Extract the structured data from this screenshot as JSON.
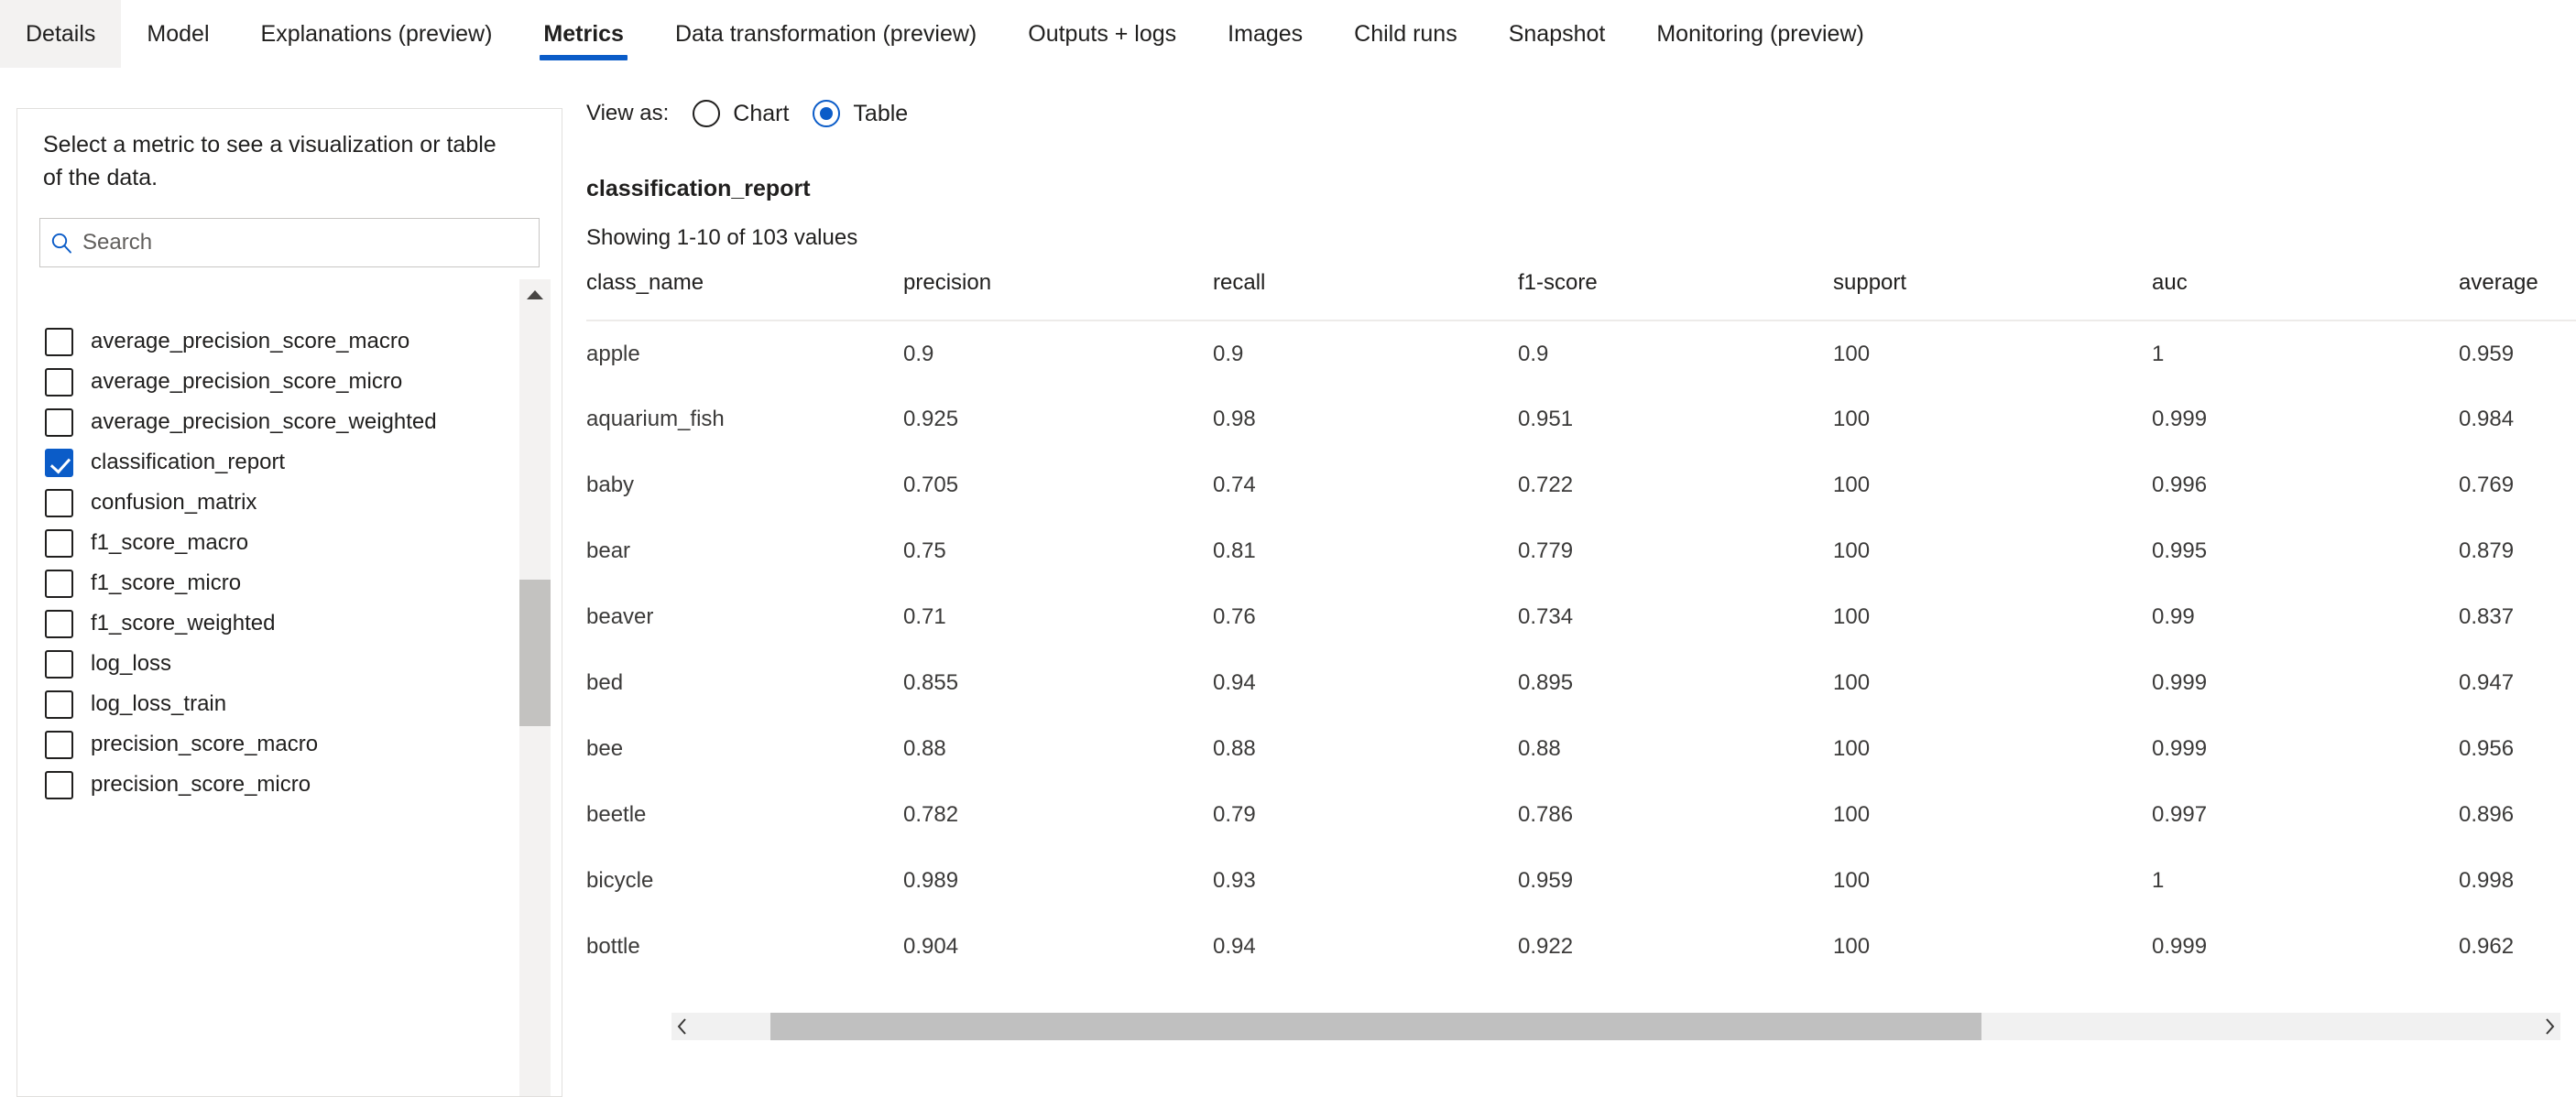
{
  "tabs": [
    {
      "label": "Details",
      "state": "hovered"
    },
    {
      "label": "Model",
      "state": "normal"
    },
    {
      "label": "Explanations (preview)",
      "state": "normal"
    },
    {
      "label": "Metrics",
      "state": "active"
    },
    {
      "label": "Data transformation (preview)",
      "state": "normal"
    },
    {
      "label": "Outputs + logs",
      "state": "normal"
    },
    {
      "label": "Images",
      "state": "normal"
    },
    {
      "label": "Child runs",
      "state": "normal"
    },
    {
      "label": "Snapshot",
      "state": "normal"
    },
    {
      "label": "Monitoring (preview)",
      "state": "normal"
    }
  ],
  "sidebar": {
    "hint": "Select a metric to see a visualization or table of the data.",
    "search_placeholder": "Search",
    "search_value": "",
    "search_icon": "search-icon",
    "metrics": [
      {
        "label": "average_precision_score_macro",
        "checked": false
      },
      {
        "label": "average_precision_score_micro",
        "checked": false
      },
      {
        "label": "average_precision_score_weighted",
        "checked": false
      },
      {
        "label": "classification_report",
        "checked": true
      },
      {
        "label": "confusion_matrix",
        "checked": false
      },
      {
        "label": "f1_score_macro",
        "checked": false
      },
      {
        "label": "f1_score_micro",
        "checked": false
      },
      {
        "label": "f1_score_weighted",
        "checked": false
      },
      {
        "label": "log_loss",
        "checked": false
      },
      {
        "label": "log_loss_train",
        "checked": false
      },
      {
        "label": "precision_score_macro",
        "checked": false
      },
      {
        "label": "precision_score_micro",
        "checked": false
      }
    ],
    "scroll_up_icon": "chevron-up-icon"
  },
  "main": {
    "view_as_label": "View as:",
    "view_options": [
      {
        "label": "Chart",
        "selected": false
      },
      {
        "label": "Table",
        "selected": true
      }
    ],
    "metric_title": "classification_report",
    "showing": "Showing 1-10 of 103 values",
    "scroll_left_icon": "chevron-left-icon",
    "scroll_right_icon": "chevron-right-icon"
  },
  "colors": {
    "accent": "#0b5cc8",
    "tab_hover_bg": "#f3f2f1",
    "border": "#e1dfdd",
    "scroll_thumb": "#c0c0c0"
  },
  "chart_data": {
    "type": "table",
    "title": "classification_report",
    "columns": [
      "class_name",
      "precision",
      "recall",
      "f1-score",
      "support",
      "auc",
      "average"
    ],
    "rows": [
      [
        "apple",
        "0.9",
        "0.9",
        "0.9",
        "100",
        "1",
        "0.959"
      ],
      [
        "aquarium_fish",
        "0.925",
        "0.98",
        "0.951",
        "100",
        "0.999",
        "0.984"
      ],
      [
        "baby",
        "0.705",
        "0.74",
        "0.722",
        "100",
        "0.996",
        "0.769"
      ],
      [
        "bear",
        "0.75",
        "0.81",
        "0.779",
        "100",
        "0.995",
        "0.879"
      ],
      [
        "beaver",
        "0.71",
        "0.76",
        "0.734",
        "100",
        "0.99",
        "0.837"
      ],
      [
        "bed",
        "0.855",
        "0.94",
        "0.895",
        "100",
        "0.999",
        "0.947"
      ],
      [
        "bee",
        "0.88",
        "0.88",
        "0.88",
        "100",
        "0.999",
        "0.956"
      ],
      [
        "beetle",
        "0.782",
        "0.79",
        "0.786",
        "100",
        "0.997",
        "0.896"
      ],
      [
        "bicycle",
        "0.989",
        "0.93",
        "0.959",
        "100",
        "1",
        "0.998"
      ],
      [
        "bottle",
        "0.904",
        "0.94",
        "0.922",
        "100",
        "0.999",
        "0.962"
      ]
    ]
  }
}
